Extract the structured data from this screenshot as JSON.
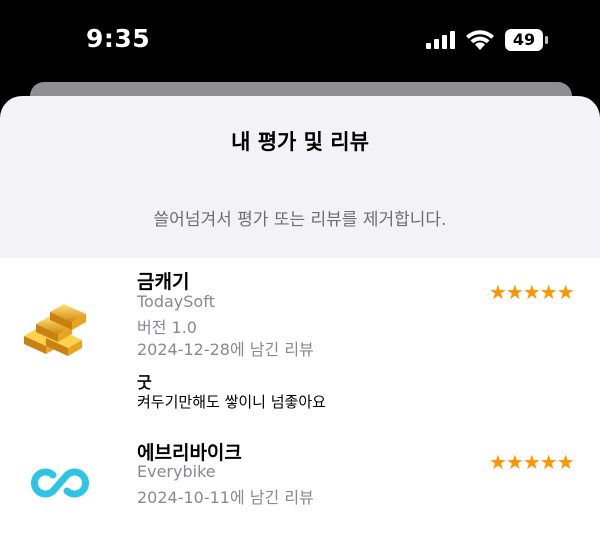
{
  "status_bar": {
    "time": "9:35",
    "battery": "49"
  },
  "sheet": {
    "title": "내 평가 및 리뷰",
    "hint": "쓸어넘겨서 평가 또는 리뷰를 제거합니다."
  },
  "reviews": [
    {
      "app_name": "금캐기",
      "developer": "TodaySoft",
      "version": "버전 1.0",
      "date": "2024-12-28에 남긴 리뷰",
      "stars": "★★★★★",
      "rating": 5,
      "review_title": "굿",
      "review_body": "켜두기만해도 쌓이니 넘좋아요"
    },
    {
      "app_name": "에브리바이크",
      "developer": "Everybike",
      "date": "2024-10-11에 남긴 리뷰",
      "stars": "★★★★★",
      "rating": 5
    }
  ],
  "colors": {
    "star": "#ff9500",
    "bike_icon": "#2ec4e6",
    "gold": "#e6a817"
  }
}
